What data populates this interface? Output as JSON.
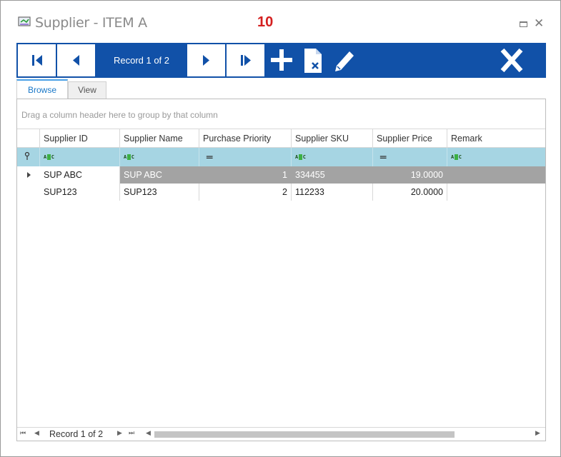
{
  "window": {
    "title": "Supplier - ITEM A",
    "badge": "10"
  },
  "toolbar": {
    "record_label": "Record 1 of 2",
    "accent_color": "#1151a8"
  },
  "tabs": [
    {
      "label": "Browse",
      "active": true
    },
    {
      "label": "View",
      "active": false
    }
  ],
  "grid": {
    "group_hint": "Drag a column header here to group by that column",
    "columns": [
      "Supplier ID",
      "Supplier Name",
      "Purchase Priority",
      "Supplier SKU",
      "Supplier Price",
      "Remark"
    ],
    "rows": [
      {
        "supplier_id": "SUP ABC",
        "supplier_name": "SUP ABC",
        "priority": "1",
        "sku": "334455",
        "price": "19.0000",
        "remark": ""
      },
      {
        "supplier_id": "SUP123",
        "supplier_name": "SUP123",
        "priority": "2",
        "sku": "112233",
        "price": "20.0000",
        "remark": ""
      }
    ],
    "selected_row": 0
  },
  "footer": {
    "record_label": "Record 1 of 2"
  },
  "icons": [
    "window-app-icon",
    "first-record-icon",
    "previous-record-icon",
    "next-record-icon",
    "last-record-icon",
    "add-icon",
    "delete-icon",
    "edit-icon",
    "close-icon",
    "filter-pin-icon",
    "row-indicator-icon"
  ]
}
